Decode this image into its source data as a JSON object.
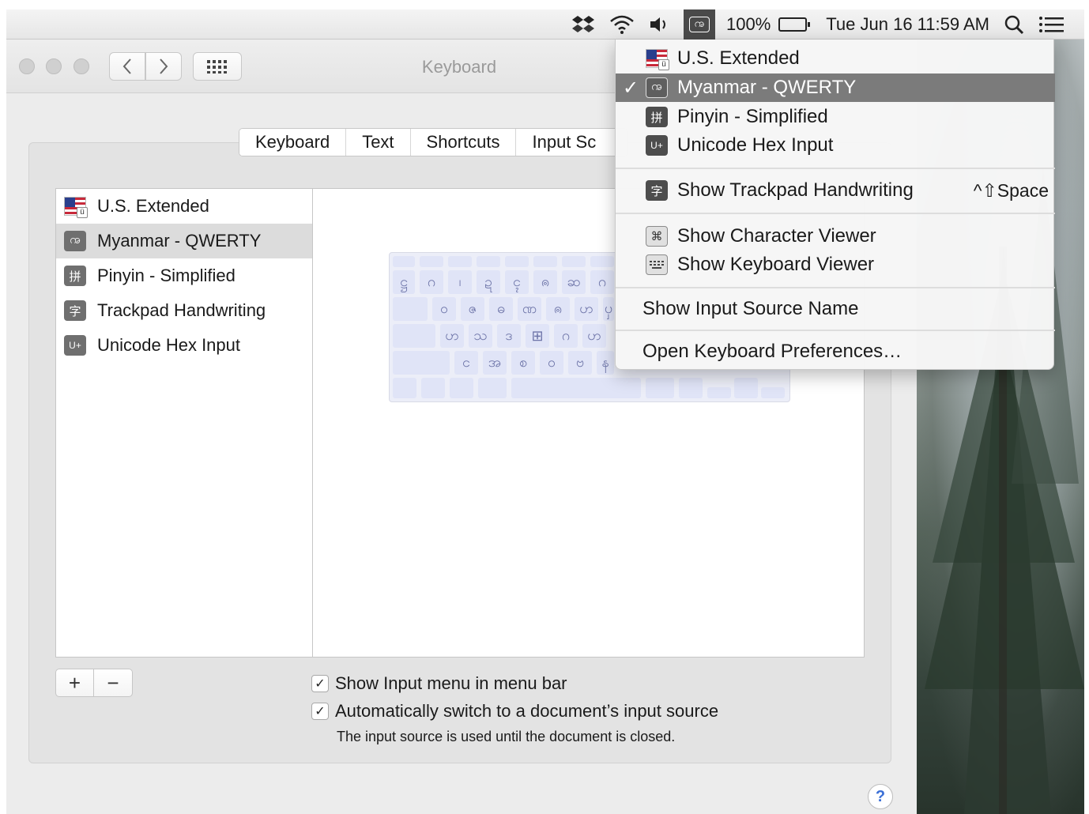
{
  "menubar": {
    "battery_pct": "100%",
    "datetime": "Tue Jun 16  11:59 AM",
    "input_icon_glyph": "ꩠ",
    "icons": [
      "dropbox-icon",
      "wifi-icon",
      "volume-icon",
      "input-menu-icon",
      "battery-icon",
      "spotlight-icon",
      "notification-center-icon"
    ]
  },
  "window": {
    "title": "Keyboard",
    "tabs": [
      "Keyboard",
      "Text",
      "Shortcuts",
      "Input Sc"
    ]
  },
  "sources": [
    {
      "label": "U.S. Extended",
      "icon": "us-flag-icon"
    },
    {
      "label": "Myanmar - QWERTY",
      "icon_glyph": "ꩠ",
      "icon": "myanmar-icon"
    },
    {
      "label": "Pinyin - Simplified",
      "icon_glyph": "拼",
      "icon": "pinyin-icon"
    },
    {
      "label": "Trackpad Handwriting",
      "icon_glyph": "字",
      "icon": "handwriting-icon"
    },
    {
      "label": "Unicode Hex Input",
      "icon_glyph": "U+",
      "icon": "unicode-icon"
    }
  ],
  "keyboard_preview": {
    "row1": [
      "ဋ္ဌ",
      "ဂ",
      "၊",
      "ဍ",
      "ၚ",
      "ၐ",
      "ဆ",
      "ဂ"
    ],
    "row2": [
      "ဝ",
      "ဇ",
      "ဓ",
      "ဏ",
      "ၐ",
      "ဟ",
      "ၦ"
    ],
    "row3": [
      "ဟ",
      "သ",
      "ဒ",
      "⊞",
      "ဂ",
      "ဟ"
    ],
    "row4": [
      "င",
      "အ",
      "စ",
      "ဝ",
      "ဗ",
      "န"
    ]
  },
  "controls": {
    "plus": "+",
    "minus": "−",
    "show_input_menu": "Show Input menu in menu bar",
    "auto_switch": "Automatically switch to a document’s input source",
    "note": "The input source is used until the document is closed.",
    "help": "?"
  },
  "menu": {
    "sources": [
      {
        "label": "U.S. Extended",
        "checked": false
      },
      {
        "label": "Myanmar - QWERTY",
        "checked": true,
        "glyph": "ꩠ"
      },
      {
        "label": "Pinyin - Simplified",
        "glyph": "拼"
      },
      {
        "label": "Unicode Hex Input",
        "glyph": "U+"
      }
    ],
    "handwriting": {
      "label": "Show Trackpad Handwriting",
      "glyph": "字",
      "shortcut": "^⇧Space"
    },
    "character_viewer": "Show Character Viewer",
    "keyboard_viewer": "Show Keyboard Viewer",
    "show_source_name": "Show Input Source Name",
    "open_prefs": "Open Keyboard Preferences…",
    "check_mark": "✓"
  }
}
